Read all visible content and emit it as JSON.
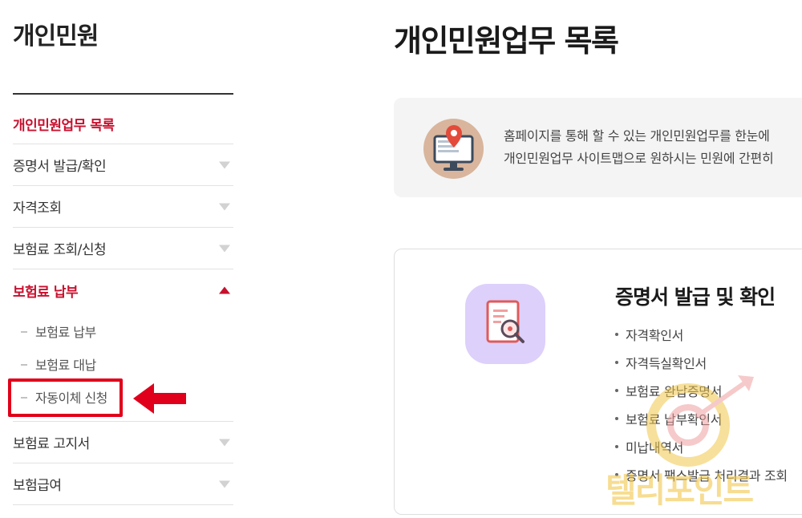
{
  "sidebar": {
    "title": "개인민원",
    "menu": [
      {
        "label": "개인민원업무 목록"
      },
      {
        "label": "증명서 발급/확인"
      },
      {
        "label": "자격조회"
      },
      {
        "label": "보험료 조회/신청"
      },
      {
        "label": "보험료 납부"
      },
      {
        "label": "보험료 고지서"
      },
      {
        "label": "보험급여"
      }
    ],
    "submenu": [
      {
        "label": "보험료 납부"
      },
      {
        "label": "보험료 대납"
      },
      {
        "label": "자동이체 신청"
      }
    ]
  },
  "main": {
    "title": "개인민원업무 목록",
    "intro": {
      "line1": "홈페이지를 통해 할 수 있는 개인민원업무를 한눈에",
      "line2": "개인민원업무 사이트맵으로 원하시는 민원에 간편히"
    },
    "card": {
      "title": "증명서 발급 및 확인",
      "items": [
        "자격확인서",
        "자격득실확인서",
        "보험료 완납증명서",
        "보험료 납부확인서",
        "미납내역서",
        "증명서 팩스발급 처리결과 조회"
      ]
    }
  },
  "watermark": {
    "text": "텔리포인트"
  },
  "colors": {
    "accent": "#c8102e",
    "annotation_red": "#e0001b",
    "intro_bg": "#f4f4f4",
    "intro_icon_bg": "#d8b59c",
    "card_icon_bg": "#ddd0fb"
  }
}
